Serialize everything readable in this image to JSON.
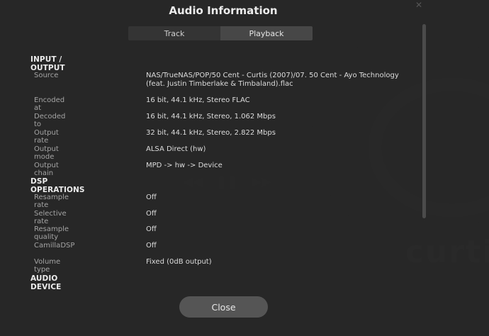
{
  "dialog": {
    "title": "Audio Information",
    "tabs": [
      {
        "label": "Track"
      },
      {
        "label": "Playback",
        "active": true
      }
    ],
    "close_label": "Close"
  },
  "sections": {
    "io": {
      "heading": "INPUT / OUTPUT",
      "rows": [
        {
          "label": "Source",
          "value": "NAS/TrueNAS/POP/50 Cent - Curtis (2007)/07. 50 Cent - Ayo Technology (feat. Justin Timberlake & Timbaland).flac"
        },
        {
          "label": "Encoded at",
          "value": "16 bit, 44.1 kHz, Stereo FLAC"
        },
        {
          "label": "Decoded to",
          "value": "16 bit, 44.1 kHz, Stereo, 1.062 Mbps"
        },
        {
          "label": "Output rate",
          "value": "32 bit, 44.1 kHz, Stereo, 2.822 Mbps"
        },
        {
          "label": "Output mode",
          "value": "ALSA Direct (hw)"
        },
        {
          "label": "Output chain",
          "value": "MPD -> hw -> Device"
        }
      ]
    },
    "dsp": {
      "heading": "DSP OPERATIONS",
      "rows": [
        {
          "label": "Resample rate",
          "value": "Off"
        },
        {
          "label": "Selective rate",
          "value": "Off"
        },
        {
          "label": "Resample quality",
          "value": "Off"
        },
        {
          "label": "CamillaDSP",
          "value": "Off"
        },
        {
          "label": "Volume type",
          "value": "Fixed (0dB output)"
        }
      ]
    },
    "device": {
      "heading": "AUDIO DEVICE"
    }
  },
  "background": {
    "ghost_text": "curtis"
  }
}
